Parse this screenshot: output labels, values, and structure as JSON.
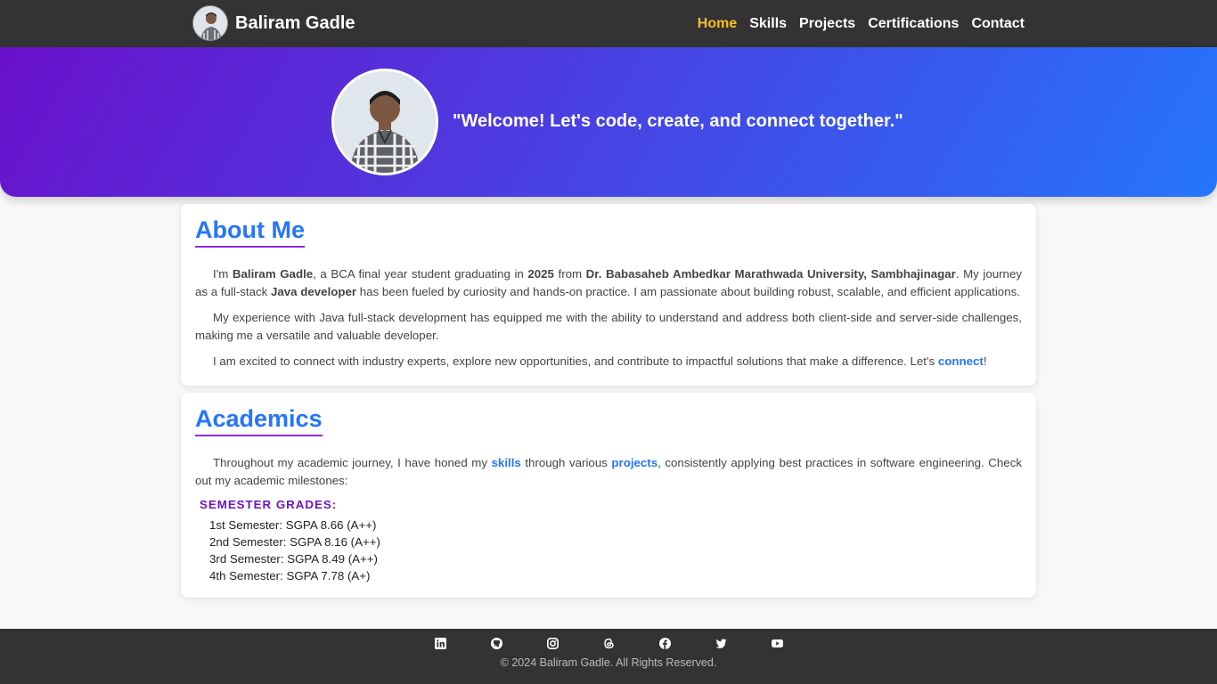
{
  "nav": {
    "brand": "Baliram Gadle",
    "links": [
      "Home",
      "Skills",
      "Projects",
      "Certifications",
      "Contact"
    ],
    "active_color": "#fbbf24"
  },
  "hero": {
    "quote": "\"Welcome! Let's code, create, and connect together.\"",
    "gradient": [
      "#6a11cb",
      "#2575fc"
    ]
  },
  "about": {
    "title": "About Me",
    "p1": {
      "t1": "I'm ",
      "name": "Baliram Gadle",
      "t2": ", a BCA final year student graduating in ",
      "year": "2025",
      "t3": " from ",
      "university": "Dr. Babasaheb Ambedkar Marathwada University, Sambhajinagar",
      "t4": ". My journey as a full-stack ",
      "role": "Java developer",
      "t5": " has been fueled by curiosity and hands-on practice. I am passionate about building robust, scalable, and efficient applications."
    },
    "p2": "My experience with Java full-stack development has equipped me with the ability to understand and address both client-side and server-side challenges, making me a versatile and valuable developer.",
    "p3": {
      "t1": "I am excited to connect with industry experts, explore new opportunities, and contribute to impactful solutions that make a difference. Let's ",
      "link": "connect",
      "t2": "!"
    }
  },
  "academics": {
    "title": "Academics",
    "p1": {
      "t1": "Throughout my academic journey, I have honed my ",
      "link1": "skills",
      "t2": " through various ",
      "link2": "projects",
      "t3": ", consistently applying best practices in software engineering. Check out my academic milestones:"
    },
    "grades_title": "SEMESTER GRADES:",
    "grades": [
      "1st Semester: SGPA 8.66 (A++)",
      "2nd Semester: SGPA 8.16 (A++)",
      "3rd Semester: SGPA 8.49 (A++)",
      "4th Semester: SGPA 7.78 (A+)"
    ]
  },
  "footer": {
    "social_icons": [
      "linkedin-icon",
      "github-icon",
      "instagram-icon",
      "threads-icon",
      "facebook-icon",
      "twitter-icon",
      "youtube-icon"
    ],
    "copyright": "© 2024 Baliram Gadle. All Rights Reserved."
  },
  "colors": {
    "accent": "#2575fc",
    "purple": "#7013c7",
    "nav_bg": "#333333"
  }
}
